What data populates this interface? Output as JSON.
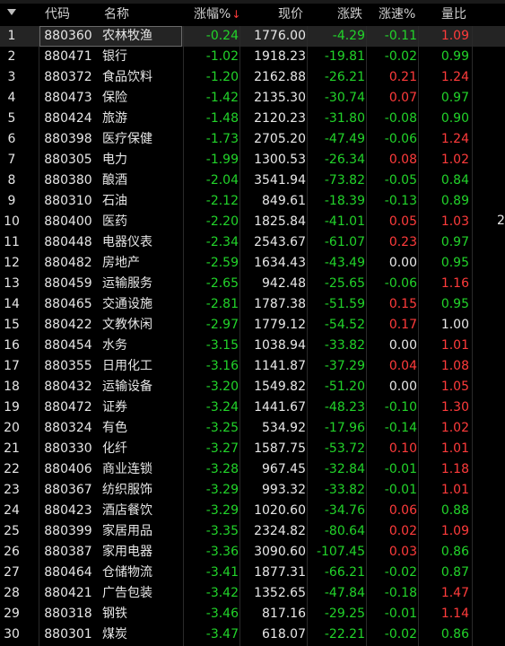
{
  "header": {
    "code": "代码",
    "name": "名称",
    "pct": "涨幅%",
    "pct_sort": "↓",
    "price": "现价",
    "change": "涨跌",
    "speed": "涨速%",
    "volratio": "量比"
  },
  "edge_text": "2",
  "rows": [
    {
      "idx": "1",
      "code": "880360",
      "name": "农林牧渔",
      "pct": "-0.24",
      "price": "1776.00",
      "change": "-4.29",
      "speed": "-0.11",
      "volratio": "1.09"
    },
    {
      "idx": "2",
      "code": "880471",
      "name": "银行",
      "pct": "-1.02",
      "price": "1918.23",
      "change": "-19.81",
      "speed": "-0.02",
      "volratio": "0.99"
    },
    {
      "idx": "3",
      "code": "880372",
      "name": "食品饮料",
      "pct": "-1.20",
      "price": "2162.88",
      "change": "-26.21",
      "speed": "0.21",
      "volratio": "1.24"
    },
    {
      "idx": "4",
      "code": "880473",
      "name": "保险",
      "pct": "-1.42",
      "price": "2135.30",
      "change": "-30.74",
      "speed": "0.07",
      "volratio": "0.97"
    },
    {
      "idx": "5",
      "code": "880424",
      "name": "旅游",
      "pct": "-1.48",
      "price": "2120.23",
      "change": "-31.80",
      "speed": "-0.08",
      "volratio": "0.90"
    },
    {
      "idx": "6",
      "code": "880398",
      "name": "医疗保健",
      "pct": "-1.73",
      "price": "2705.20",
      "change": "-47.49",
      "speed": "-0.06",
      "volratio": "1.24"
    },
    {
      "idx": "7",
      "code": "880305",
      "name": "电力",
      "pct": "-1.99",
      "price": "1300.53",
      "change": "-26.34",
      "speed": "0.08",
      "volratio": "1.02"
    },
    {
      "idx": "8",
      "code": "880380",
      "name": "酿酒",
      "pct": "-2.04",
      "price": "3541.94",
      "change": "-73.82",
      "speed": "-0.05",
      "volratio": "0.84"
    },
    {
      "idx": "9",
      "code": "880310",
      "name": "石油",
      "pct": "-2.12",
      "price": "849.61",
      "change": "-18.39",
      "speed": "-0.13",
      "volratio": "0.89"
    },
    {
      "idx": "10",
      "code": "880400",
      "name": "医药",
      "pct": "-2.20",
      "price": "1825.84",
      "change": "-41.01",
      "speed": "0.05",
      "volratio": "1.03"
    },
    {
      "idx": "11",
      "code": "880448",
      "name": "电器仪表",
      "pct": "-2.34",
      "price": "2543.67",
      "change": "-61.07",
      "speed": "0.23",
      "volratio": "0.97"
    },
    {
      "idx": "12",
      "code": "880482",
      "name": "房地产",
      "pct": "-2.59",
      "price": "1634.43",
      "change": "-43.49",
      "speed": "0.00",
      "volratio": "0.95"
    },
    {
      "idx": "13",
      "code": "880459",
      "name": "运输服务",
      "pct": "-2.65",
      "price": "942.48",
      "change": "-25.65",
      "speed": "-0.06",
      "volratio": "1.16"
    },
    {
      "idx": "14",
      "code": "880465",
      "name": "交通设施",
      "pct": "-2.81",
      "price": "1787.38",
      "change": "-51.59",
      "speed": "0.15",
      "volratio": "0.95"
    },
    {
      "idx": "15",
      "code": "880422",
      "name": "文教休闲",
      "pct": "-2.97",
      "price": "1779.12",
      "change": "-54.52",
      "speed": "0.17",
      "volratio": "1.00"
    },
    {
      "idx": "16",
      "code": "880454",
      "name": "水务",
      "pct": "-3.15",
      "price": "1038.94",
      "change": "-33.82",
      "speed": "0.00",
      "volratio": "1.01"
    },
    {
      "idx": "17",
      "code": "880355",
      "name": "日用化工",
      "pct": "-3.16",
      "price": "1141.87",
      "change": "-37.29",
      "speed": "0.04",
      "volratio": "1.08"
    },
    {
      "idx": "18",
      "code": "880432",
      "name": "运输设备",
      "pct": "-3.20",
      "price": "1549.82",
      "change": "-51.20",
      "speed": "0.00",
      "volratio": "1.05"
    },
    {
      "idx": "19",
      "code": "880472",
      "name": "证券",
      "pct": "-3.24",
      "price": "1441.67",
      "change": "-48.23",
      "speed": "-0.10",
      "volratio": "1.30"
    },
    {
      "idx": "20",
      "code": "880324",
      "name": "有色",
      "pct": "-3.25",
      "price": "534.92",
      "change": "-17.96",
      "speed": "-0.14",
      "volratio": "1.02"
    },
    {
      "idx": "21",
      "code": "880330",
      "name": "化纤",
      "pct": "-3.27",
      "price": "1587.75",
      "change": "-53.72",
      "speed": "0.10",
      "volratio": "1.01"
    },
    {
      "idx": "22",
      "code": "880406",
      "name": "商业连锁",
      "pct": "-3.28",
      "price": "967.45",
      "change": "-32.84",
      "speed": "-0.01",
      "volratio": "1.18"
    },
    {
      "idx": "23",
      "code": "880367",
      "name": "纺织服饰",
      "pct": "-3.29",
      "price": "993.32",
      "change": "-33.82",
      "speed": "-0.01",
      "volratio": "1.01"
    },
    {
      "idx": "24",
      "code": "880423",
      "name": "酒店餐饮",
      "pct": "-3.29",
      "price": "1020.60",
      "change": "-34.76",
      "speed": "0.06",
      "volratio": "0.88"
    },
    {
      "idx": "25",
      "code": "880399",
      "name": "家居用品",
      "pct": "-3.35",
      "price": "2324.82",
      "change": "-80.64",
      "speed": "0.02",
      "volratio": "1.09"
    },
    {
      "idx": "26",
      "code": "880387",
      "name": "家用电器",
      "pct": "-3.36",
      "price": "3090.60",
      "change": "-107.45",
      "speed": "0.03",
      "volratio": "0.86"
    },
    {
      "idx": "27",
      "code": "880464",
      "name": "仓储物流",
      "pct": "-3.41",
      "price": "1877.31",
      "change": "-66.21",
      "speed": "-0.02",
      "volratio": "0.87"
    },
    {
      "idx": "28",
      "code": "880421",
      "name": "广告包装",
      "pct": "-3.42",
      "price": "1352.65",
      "change": "-47.84",
      "speed": "-0.18",
      "volratio": "1.47"
    },
    {
      "idx": "29",
      "code": "880318",
      "name": "钢铁",
      "pct": "-3.46",
      "price": "817.16",
      "change": "-29.25",
      "speed": "-0.01",
      "volratio": "1.14"
    },
    {
      "idx": "30",
      "code": "880301",
      "name": "煤炭",
      "pct": "-3.47",
      "price": "618.07",
      "change": "-22.21",
      "speed": "-0.02",
      "volratio": "0.86"
    }
  ]
}
